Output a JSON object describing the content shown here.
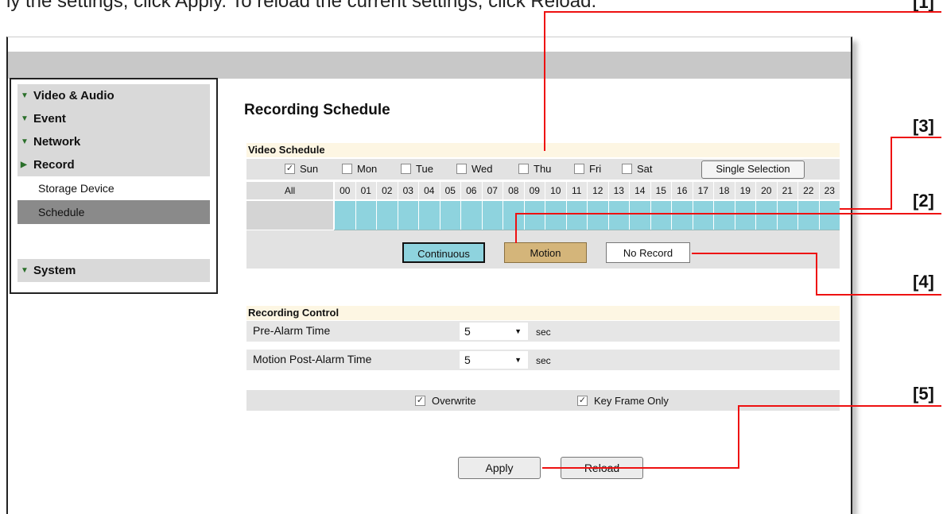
{
  "top_text": "ly the settings, click Apply. To reload the current settings, click Reload.",
  "callouts": [
    "[1]",
    "[3]",
    "[2]",
    "[4]",
    "[5]"
  ],
  "sidebar": {
    "items": [
      {
        "label": "Video & Audio",
        "arrow": "down"
      },
      {
        "label": "Event",
        "arrow": "down"
      },
      {
        "label": "Network",
        "arrow": "down"
      },
      {
        "label": "Record",
        "arrow": "right"
      }
    ],
    "sub_items": [
      "Storage Device",
      "Schedule"
    ],
    "active_sub": "Schedule",
    "system": "System"
  },
  "page_title": "Recording Schedule",
  "video_schedule": {
    "title": "Video Schedule",
    "days": [
      {
        "label": "Sun",
        "checked": true
      },
      {
        "label": "Mon",
        "checked": false
      },
      {
        "label": "Tue",
        "checked": false
      },
      {
        "label": "Wed",
        "checked": false
      },
      {
        "label": "Thu",
        "checked": false
      },
      {
        "label": "Fri",
        "checked": false
      },
      {
        "label": "Sat",
        "checked": false
      }
    ],
    "single_selection": "Single Selection",
    "all_label": "All",
    "hours": [
      "00",
      "01",
      "02",
      "03",
      "04",
      "05",
      "06",
      "07",
      "08",
      "09",
      "10",
      "11",
      "12",
      "13",
      "14",
      "15",
      "16",
      "17",
      "18",
      "19",
      "20",
      "21",
      "22",
      "23"
    ],
    "legend": {
      "continuous": "Continuous",
      "motion": "Motion",
      "no_record": "No Record"
    }
  },
  "recording_control": {
    "title": "Recording Control",
    "pre_alarm_label": "Pre-Alarm Time",
    "pre_alarm_value": "5",
    "post_alarm_label": "Motion Post-Alarm Time",
    "post_alarm_value": "5",
    "unit": "sec"
  },
  "options": {
    "overwrite": "Overwrite",
    "overwrite_checked": true,
    "key_frame": "Key Frame Only",
    "key_frame_checked": true
  },
  "buttons": {
    "apply": "Apply",
    "reload": "Reload"
  },
  "colors": {
    "continuous": "#8ed3de",
    "motion": "#d4b57a",
    "callout_line": "#e11111",
    "header_bar": "#c8c8c8"
  }
}
